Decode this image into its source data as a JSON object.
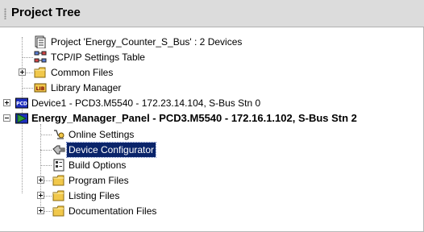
{
  "panel": {
    "title": "Project Tree"
  },
  "tree": {
    "root": {
      "label": "Project 'Energy_Counter_S_Bus' : 2 Devices"
    },
    "items": [
      {
        "label": "TCP/IP Settings Table"
      },
      {
        "label": "Common Files"
      },
      {
        "label": "Library Manager"
      },
      {
        "label": "Device1 - PCD3.M5540 - 172.23.14.104, S-Bus Stn 0"
      },
      {
        "label": "Energy_Manager_Panel - PCD3.M5540 - 172.16.1.102, S-Bus Stn 2"
      },
      {
        "label": "Online Settings"
      },
      {
        "label": "Device Configurator"
      },
      {
        "label": "Build Options"
      },
      {
        "label": "Program Files"
      },
      {
        "label": "Listing Files"
      },
      {
        "label": "Documentation Files"
      }
    ]
  },
  "colors": {
    "selection": "#0a246a",
    "folder": "#f1c84b",
    "active_device": "#2e9b3a"
  }
}
